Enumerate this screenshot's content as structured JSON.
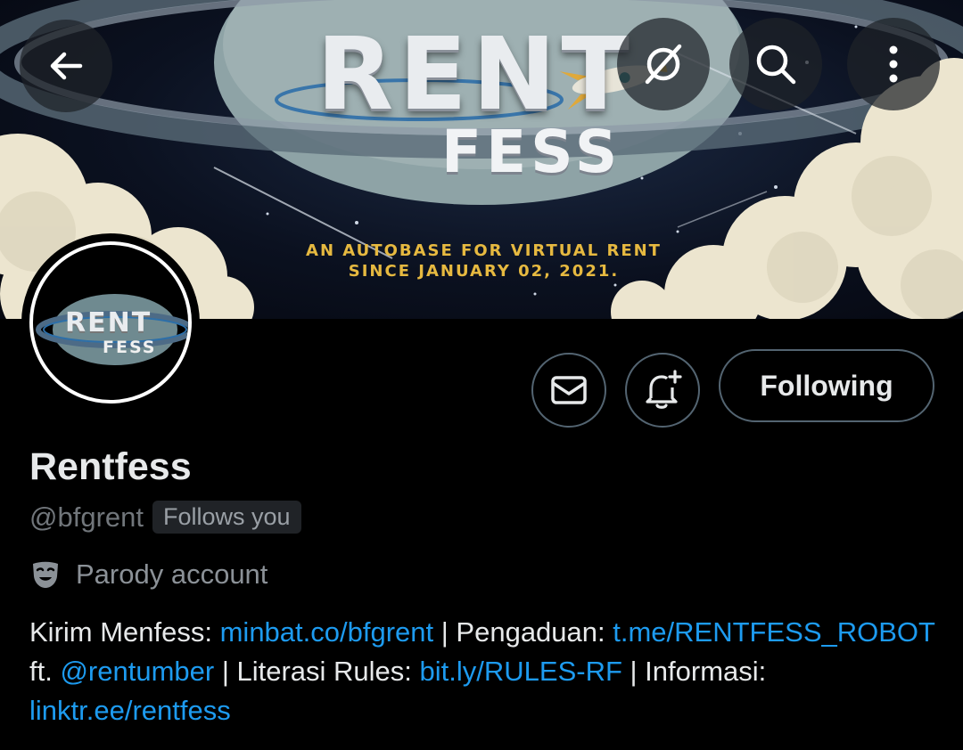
{
  "banner": {
    "title_rent": "RENT",
    "title_fess": "FESS",
    "tagline_line1": "AN AUTOBASE FOR VIRTUAL RENT",
    "tagline_line2": "SINCE JANUARY 02, 2021."
  },
  "nav": {
    "back_icon": "arrow-left-icon",
    "grok_icon": "slash-circle-icon",
    "search_icon": "search-icon",
    "more_icon": "more-vertical-icon"
  },
  "avatar": {
    "rent": "RENT",
    "fess": "FESS"
  },
  "actions": {
    "message_icon": "envelope-icon",
    "notify_icon": "bell-plus-icon",
    "following_label": "Following"
  },
  "profile": {
    "display_name": "Rentfess",
    "handle": "@bfgrent",
    "follows_you": "Follows you",
    "parody_label": "Parody account",
    "parody_icon": "theater-mask-icon"
  },
  "bio": {
    "t1": "Kirim Menfess: ",
    "l1": "minbat.co/bfgrent",
    "t2": " | Pengaduan: ",
    "l2": "t.me/​RENTFESS_ROBOT",
    "t3": " ft. ",
    "l3": "@rentumber",
    "t4": " | Literasi Rules: ",
    "l4": "bit.ly/​RULES-RF",
    "t5": " | Informasi: ",
    "l5": "linktr.ee/rentfess"
  },
  "colors": {
    "link": "#1d9bf0",
    "tagline": "#e6b940",
    "border": "#536471"
  }
}
